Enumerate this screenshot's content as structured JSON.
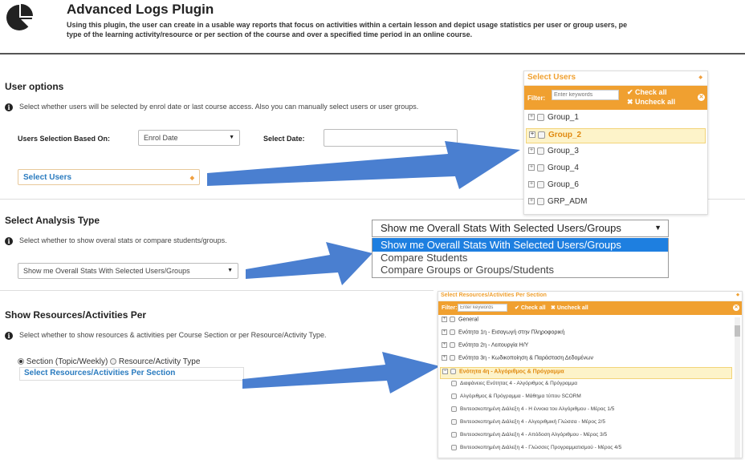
{
  "header": {
    "title": "Advanced Logs Plugin",
    "description": "Using this plugin, the user can create in a usable way reports that focus on activities within a certain lesson and depict usage statistics per user or group users, pe",
    "description2": "type of the learning activity/resource or per section of the course and over a specified time period in an online course."
  },
  "user_options": {
    "heading": "User options",
    "info": "Select whether users will be selected by enrol date or last course access. Also you can manually select users or user groups.",
    "selection_label": "Users Selection Based On:",
    "selection_value": "Enrol Date",
    "date_label": "Select Date:",
    "date_value": "",
    "select_users": "Select Users"
  },
  "users_panel": {
    "title": "Select Users",
    "filter_label": "Filter:",
    "filter_placeholder": "Enter keywords",
    "check_all": "Check all",
    "uncheck_all": "Uncheck all",
    "groups": [
      "Group_1",
      "Group_2",
      "Group_3",
      "Group_4",
      "Group_6",
      "GRP_ADM"
    ],
    "highlighted": "Group_2"
  },
  "analysis": {
    "heading": "Select Analysis Type",
    "info": "Select whether to show overal stats or compare students/groups.",
    "select_value": "Show me Overall Stats With Selected Users/Groups",
    "dropdown_value": "Show me Overall Stats With Selected Users/Groups",
    "options": [
      "Show me Overall Stats With Selected Users/Groups",
      "Compare Students",
      "Compare Groups or Groups/Students"
    ]
  },
  "resources": {
    "heading": "Show Resources/Activities Per",
    "info": "Select whether to show resources & activities per Course Section or per Resource/Activity Type.",
    "radio_section": "Section (Topic/Weekly)",
    "radio_type": "Resource/Activity Type",
    "select_sections": "Select Resources/Activities Per Section"
  },
  "sections_panel": {
    "title": "Select Resources/Activities Per Section",
    "filter_label": "Filter:",
    "filter_placeholder": "Enter keywords",
    "check_all": "Check all",
    "uncheck_all": "Uncheck all",
    "sections": [
      "General",
      "Ενότητα 1η - Εισαγωγή στην Πληροφορική",
      "Ενότητα 2η - Λειτουργία Η/Υ",
      "Ενότητα 3η - Κωδικοποίηση & Παράσταση Δεδομένων",
      "Ενότητα 4η - Αλγόριθμος & Πρόγραμμα"
    ],
    "children": [
      "Διαφάνειες Ενότητας 4 - Αλγόριθμος & Πρόγραμμα",
      "Αλγόριθμος & Πρόγραμμα - Μάθημα τύπου SCORM",
      "Βιντεοσκοπημένη Διάλεξη 4 - Η έννοια του Αλγόριθμου - Μέρος 1/5",
      "Βιντεοσκοπημένη Διάλεξη 4 - Αλγοριθμική Γλώσσα - Μέρος 2/5",
      "Βιντεοσκοπημένη Διάλεξη 4 - Απόδοση Αλγόριθμου - Μέρος 3/5",
      "Βιντεοσκοπημένη Διάλεξη 4 - Γλώσσες Προγραμματισμού - Μέρος 4/5"
    ]
  },
  "colors": {
    "accent": "#f0a030",
    "link": "#2a7bbf",
    "arrow": "#4a7fd0",
    "selected": "#1e7fe0"
  }
}
